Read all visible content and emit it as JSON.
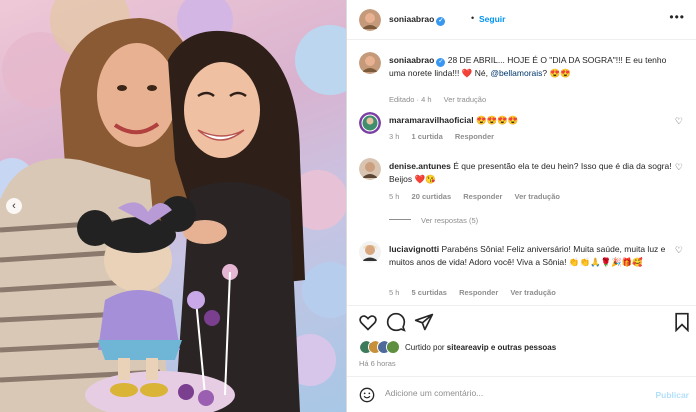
{
  "post": {
    "username": "soniaabrao",
    "follow_label": "Seguir",
    "more_label": "•••"
  },
  "caption": {
    "username": "soniaabrao",
    "text": "28 DE ABRIL... HOJE É O \"DIA DA SOGRA\"!!! E eu tenho uma norete linda!!! ❤️ Né, ",
    "mention": "@bellamorais",
    "text_end": "? 😍😍",
    "edited": "Editado · 4 h",
    "translate": "Ver tradução"
  },
  "comments": [
    {
      "username": "maramaravilhaoficial",
      "text": "😍😍😍😍",
      "time": "3 h",
      "likes": "1 curtida",
      "reply": "Responder"
    },
    {
      "username": "denise.antunes",
      "text": "É que presentão ela te deu hein? Isso que é dia da sogra! Beijos ❤️😘",
      "time": "5 h",
      "likes": "20 curtidas",
      "reply": "Responder",
      "translate": "Ver tradução",
      "view_replies": "Ver respostas (5)"
    },
    {
      "username": "luciavignotti",
      "text": "Parabéns Sônia! Feliz aniversário! Muita saúde, muita luz e muitos anos de vida! Adoro você! Viva a Sônia! 👏👏🙏🌹🎉🎁🥰",
      "time": "5 h",
      "likes": "5 curtidas",
      "reply": "Responder",
      "translate": "Ver tradução"
    }
  ],
  "likes": {
    "prefix": "Curtido por ",
    "user": "siteareavip",
    "suffix": " e outras pessoas"
  },
  "time_ago": "Há 6 horas",
  "add_comment": {
    "placeholder": "Adicione um comentário...",
    "publish": "Publicar"
  },
  "icons": {
    "header_avatar": "avatar-icon",
    "like": "heart-icon",
    "comment": "comment-icon",
    "share": "paper-plane-icon",
    "save": "bookmark-icon",
    "emoji": "smiley-icon",
    "prev": "chevron-left-icon"
  },
  "colors": {
    "link": "#00376b",
    "follow": "#0095f6",
    "verified": "#3897f0",
    "muted": "#8e8e8e",
    "heart_red": "#ed4956"
  }
}
